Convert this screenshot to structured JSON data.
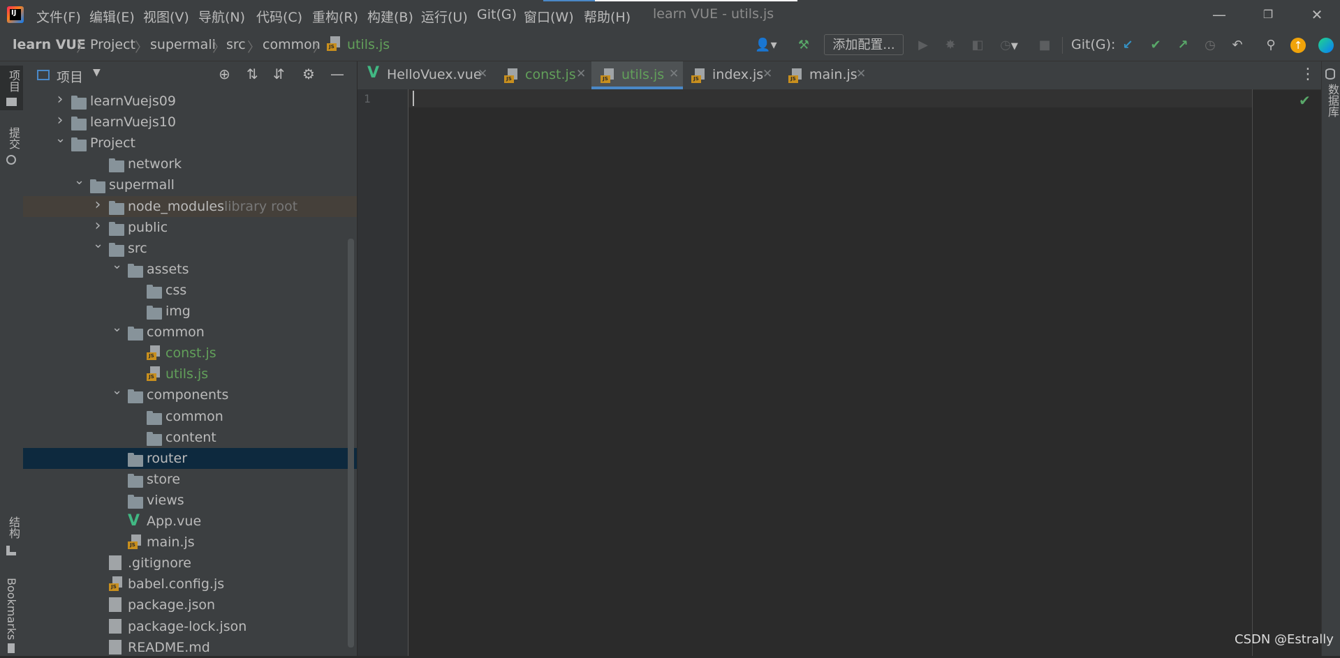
{
  "window": {
    "title": "learn VUE - utils.js",
    "app_icon_text": "IJ"
  },
  "menu": [
    "文件(F)",
    "编辑(E)",
    "视图(V)",
    "导航(N)",
    "代码(C)",
    "重构(R)",
    "构建(B)",
    "运行(U)",
    "Git(G)",
    "窗口(W)",
    "帮助(H)"
  ],
  "breadcrumb": [
    "learn VUE",
    "Project",
    "supermall",
    "src",
    "common",
    "utils.js"
  ],
  "toolbar": {
    "add_config": "添加配置...",
    "git_label": "Git(G):"
  },
  "project_panel": {
    "title": "项目",
    "tree": [
      {
        "label": "learnVuejs09",
        "type": "folder",
        "expanded": false
      },
      {
        "label": "learnVuejs10",
        "type": "folder",
        "expanded": false
      },
      {
        "label": "Project",
        "type": "folder",
        "expanded": true
      },
      {
        "label": "network",
        "type": "folder"
      },
      {
        "label": "supermall",
        "type": "folder",
        "expanded": true
      },
      {
        "label": "node_modules",
        "suffix": "library root",
        "type": "folder",
        "expanded": false
      },
      {
        "label": "public",
        "type": "folder",
        "expanded": false
      },
      {
        "label": "src",
        "type": "folder",
        "expanded": true
      },
      {
        "label": "assets",
        "type": "folder",
        "expanded": true
      },
      {
        "label": "css",
        "type": "folder"
      },
      {
        "label": "img",
        "type": "folder"
      },
      {
        "label": "common",
        "type": "folder",
        "expanded": true
      },
      {
        "label": "const.js",
        "type": "js"
      },
      {
        "label": "utils.js",
        "type": "js"
      },
      {
        "label": "components",
        "type": "folder",
        "expanded": true
      },
      {
        "label": "common",
        "type": "folder"
      },
      {
        "label": "content",
        "type": "folder"
      },
      {
        "label": "router",
        "type": "folder",
        "selected": true
      },
      {
        "label": "store",
        "type": "folder"
      },
      {
        "label": "views",
        "type": "folder"
      },
      {
        "label": "App.vue",
        "type": "vue"
      },
      {
        "label": "main.js",
        "type": "js"
      },
      {
        "label": ".gitignore",
        "type": "file"
      },
      {
        "label": "babel.config.js",
        "type": "js"
      },
      {
        "label": "package.json",
        "type": "file"
      },
      {
        "label": "package-lock.json",
        "type": "file"
      },
      {
        "label": "README.md",
        "type": "file"
      }
    ]
  },
  "tabs": [
    {
      "label": "HelloVuex.vue",
      "icon": "vue-icon"
    },
    {
      "label": "const.js",
      "icon": "js-file-icon"
    },
    {
      "label": "utils.js",
      "icon": "js-file-icon",
      "active": true
    },
    {
      "label": "index.js",
      "icon": "js-file-icon"
    },
    {
      "label": "main.js",
      "icon": "js-file-icon"
    }
  ],
  "editor": {
    "line_numbers": [
      "1"
    ]
  },
  "side_labels": {
    "left_project": "项目",
    "left_commit": "提交",
    "left_structure": "结构",
    "left_bookmarks": "Bookmarks",
    "right_database": "数据库"
  },
  "watermark": "CSDN @Estrally",
  "colors": {
    "vcs_added_green": "#62a05a",
    "accent_blue": "#4a88c7",
    "js_badge": "#c88f1e",
    "vue_green": "#41b883"
  }
}
